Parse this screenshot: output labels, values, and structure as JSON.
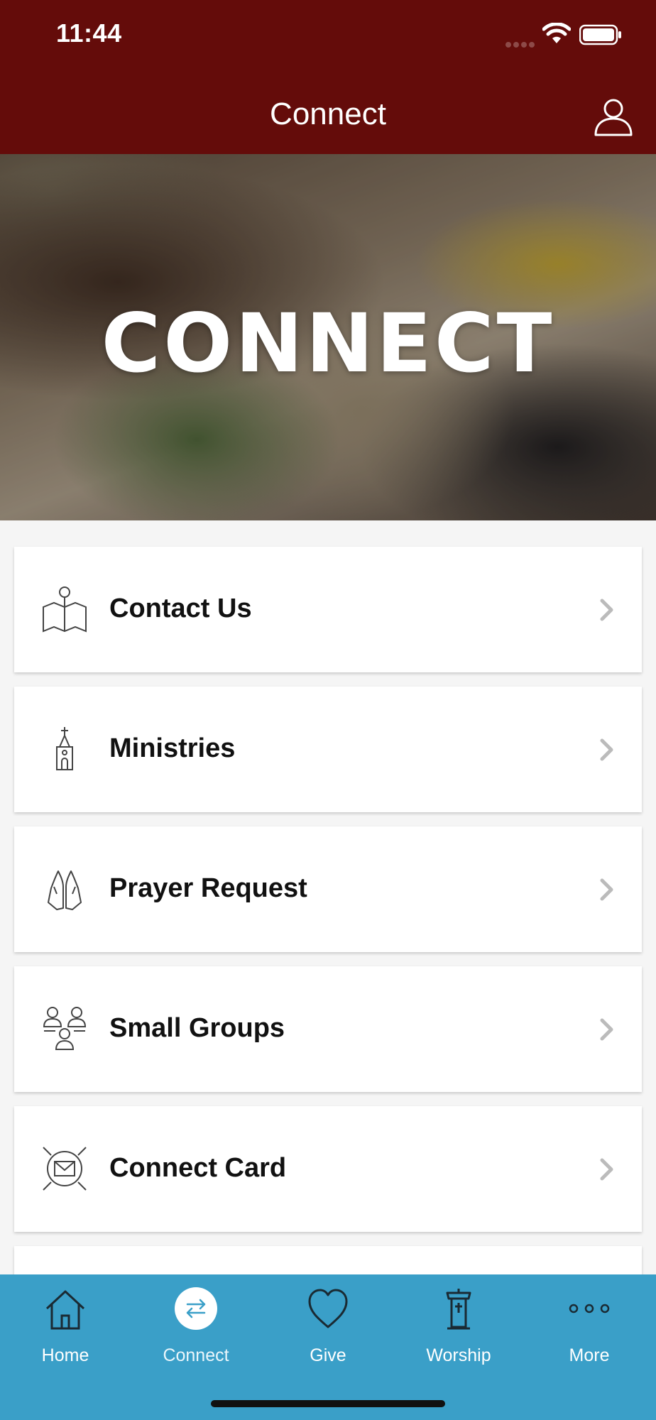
{
  "status_bar": {
    "time": "11:44"
  },
  "header": {
    "title": "Connect",
    "profile_icon": "user-outline-icon"
  },
  "hero": {
    "title": "CONNECT"
  },
  "menu": [
    {
      "label": "Contact Us",
      "icon": "map-pin-icon"
    },
    {
      "label": "Ministries",
      "icon": "church-icon"
    },
    {
      "label": "Prayer Request",
      "icon": "praying-hands-icon"
    },
    {
      "label": "Small Groups",
      "icon": "group-icon"
    },
    {
      "label": "Connect Card",
      "icon": "envelope-card-icon"
    }
  ],
  "tabs": [
    {
      "label": "Home",
      "icon": "home-icon",
      "active": false
    },
    {
      "label": "Connect",
      "icon": "arrows-exchange-icon",
      "active": true
    },
    {
      "label": "Give",
      "icon": "heart-icon",
      "active": false
    },
    {
      "label": "Worship",
      "icon": "pulpit-icon",
      "active": false
    },
    {
      "label": "More",
      "icon": "more-dots-icon",
      "active": false
    }
  ],
  "colors": {
    "header": "#640c0a",
    "tabbar": "#3a9fc8",
    "background": "#f5f5f5"
  }
}
